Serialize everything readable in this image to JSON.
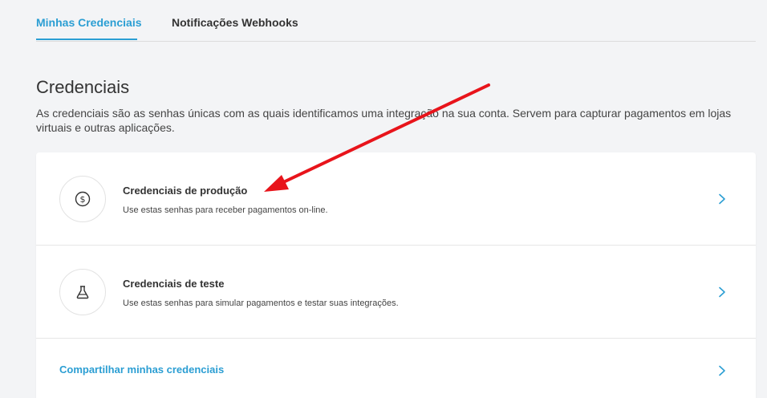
{
  "tabs": [
    {
      "label": "Minhas Credenciais",
      "active": true
    },
    {
      "label": "Notificações Webhooks",
      "active": false
    }
  ],
  "section": {
    "title": "Credenciais",
    "description": "As credenciais são as senhas únicas com as quais identificamos uma integração na sua conta. Servem para capturar pagamentos em lojas virtuais e outras aplicações."
  },
  "items": [
    {
      "title": "Credenciais de produção",
      "subtitle": "Use estas senhas para receber pagamentos on-line.",
      "icon": "dollar-coin-icon"
    },
    {
      "title": "Credenciais de teste",
      "subtitle": "Use estas senhas para simular pagamentos e testar suas integrações.",
      "icon": "flask-icon"
    }
  ],
  "share": {
    "label": "Compartilhar minhas credenciais"
  },
  "colors": {
    "accent": "#2b9ed3",
    "annotation_arrow": "#e8141b",
    "background": "#f3f4f6"
  }
}
